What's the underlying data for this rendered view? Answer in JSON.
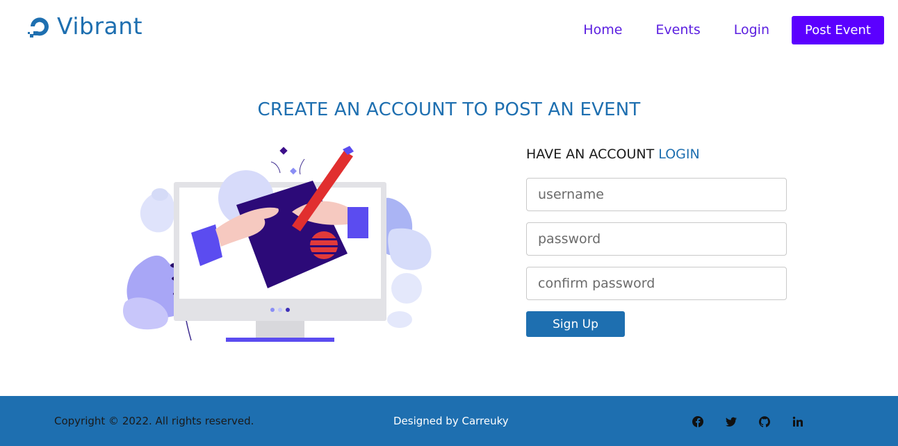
{
  "brand": {
    "name": "Vibrant",
    "color": "#1e6fb0"
  },
  "nav": {
    "items": [
      {
        "label": "Home"
      },
      {
        "label": "Events"
      },
      {
        "label": "Login"
      }
    ],
    "cta_label": "Post Event",
    "link_color": "#5b1fe0",
    "cta_color": "#5b00ff"
  },
  "page_title": "CREATE AN ACCOUNT TO POST AN EVENT",
  "form": {
    "prompt": "HAVE AN ACCOUNT",
    "login_link": "LOGIN",
    "username_placeholder": "username",
    "password_placeholder": "password",
    "confirm_placeholder": "confirm password",
    "submit_label": "Sign Up"
  },
  "footer": {
    "copyright": "Copyright © 2022. All rights reserved.",
    "credit": "Designed by Carreuky",
    "background": "#1e6fb0",
    "socials": [
      "facebook-icon",
      "twitter-icon",
      "github-icon",
      "linkedin-icon"
    ]
  }
}
